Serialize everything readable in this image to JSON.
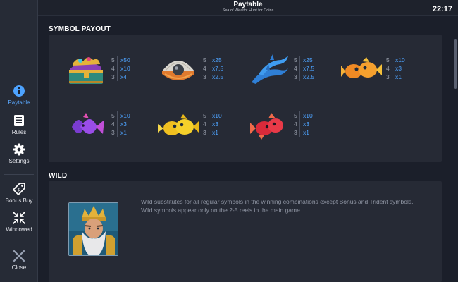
{
  "header": {
    "title": "Paytable",
    "subtitle": "Sea of Wealth: Hunt for Coins",
    "clock": "22:17"
  },
  "sidebar": {
    "items": [
      {
        "label": "Paytable",
        "icon": "info-icon",
        "active": true
      },
      {
        "label": "Rules",
        "icon": "rules-list-icon",
        "active": false
      },
      {
        "label": "Settings",
        "icon": "gear-icon",
        "active": false
      },
      {
        "label": "Bonus Buy",
        "icon": "price-tag-icon",
        "active": false
      },
      {
        "label": "Windowed",
        "icon": "windowed-arrows-icon",
        "active": false
      },
      {
        "label": "Close",
        "icon": "close-icon",
        "active": false
      }
    ]
  },
  "symbol_payout": {
    "title": "SYMBOL PAYOUT",
    "symbols": [
      {
        "name": "treasure-chest",
        "pays": [
          {
            "count": "5",
            "mult": "x50"
          },
          {
            "count": "4",
            "mult": "x10"
          },
          {
            "count": "3",
            "mult": "x4"
          }
        ]
      },
      {
        "name": "pearl-shell",
        "pays": [
          {
            "count": "5",
            "mult": "x25"
          },
          {
            "count": "4",
            "mult": "x7.5"
          },
          {
            "count": "3",
            "mult": "x2.5"
          }
        ]
      },
      {
        "name": "dolphins",
        "pays": [
          {
            "count": "5",
            "mult": "x25"
          },
          {
            "count": "4",
            "mult": "x7.5"
          },
          {
            "count": "3",
            "mult": "x2.5"
          }
        ]
      },
      {
        "name": "orange-fish",
        "pays": [
          {
            "count": "5",
            "mult": "x10"
          },
          {
            "count": "4",
            "mult": "x3"
          },
          {
            "count": "3",
            "mult": "x1"
          }
        ]
      },
      {
        "name": "purple-fish",
        "pays": [
          {
            "count": "5",
            "mult": "x10"
          },
          {
            "count": "4",
            "mult": "x3"
          },
          {
            "count": "3",
            "mult": "x1"
          }
        ]
      },
      {
        "name": "yellow-fish",
        "pays": [
          {
            "count": "5",
            "mult": "x10"
          },
          {
            "count": "4",
            "mult": "x3"
          },
          {
            "count": "3",
            "mult": "x1"
          }
        ]
      },
      {
        "name": "red-fish",
        "pays": [
          {
            "count": "5",
            "mult": "x10"
          },
          {
            "count": "4",
            "mult": "x3"
          },
          {
            "count": "3",
            "mult": "x1"
          }
        ]
      }
    ]
  },
  "wild": {
    "title": "WILD",
    "line1": "Wild substitutes for all regular symbols in the winning combinations except Bonus and Trident symbols.",
    "line2": "Wild symbols appear only on the 2-5 reels in the main game."
  },
  "colors": {
    "background": "#1b1f2a",
    "panel": "#262a35",
    "sidebar": "#262b36",
    "accent": "#4da3ff",
    "text_muted": "#8f95a3"
  }
}
